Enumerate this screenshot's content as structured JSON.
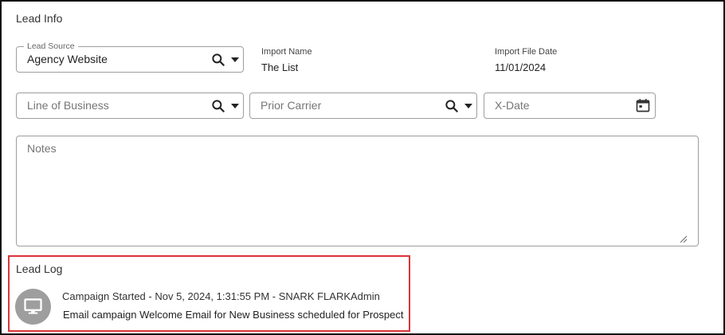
{
  "lead_info": {
    "title": "Lead Info",
    "lead_source": {
      "label": "Lead Source",
      "value": "Agency Website"
    },
    "import_name": {
      "label": "Import Name",
      "value": "The List"
    },
    "import_file_date": {
      "label": "Import File Date",
      "value": "11/01/2024"
    },
    "line_of_business": {
      "placeholder": "Line of Business"
    },
    "prior_carrier": {
      "placeholder": "Prior Carrier"
    },
    "x_date": {
      "placeholder": "X-Date"
    },
    "notes": {
      "placeholder": "Notes"
    }
  },
  "lead_log": {
    "title": "Lead Log",
    "highlight_color": "#d9353b",
    "entries": [
      {
        "icon": "monitor-icon",
        "header": "Campaign Started - Nov 5, 2024, 1:31:55 PM - SNARK FLARKAdmin",
        "message": "Email campaign Welcome Email for New Business scheduled for Prospect"
      }
    ]
  }
}
